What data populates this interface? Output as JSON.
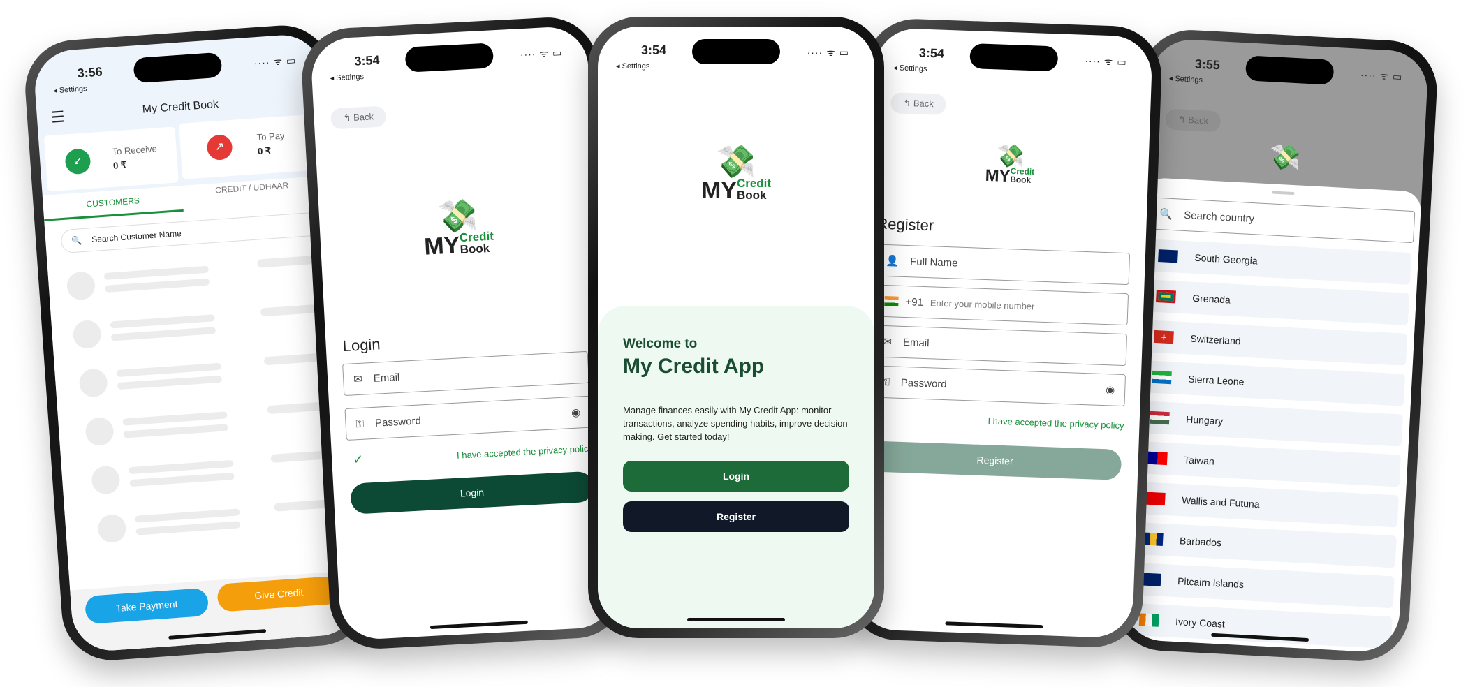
{
  "status": {
    "settings": "◂ Settings",
    "signal": "···· ᯤ ▭"
  },
  "logo": {
    "my": "MY",
    "credit": "Credit",
    "book": "Book"
  },
  "home": {
    "time": "3:56",
    "title": "My Credit Book",
    "receive_label": "To Receive",
    "receive_value": "0 ₹",
    "pay_label": "To Pay",
    "pay_value": "0 ₹",
    "tabs": [
      "CUSTOMERS",
      "CREDIT / UDHAAR"
    ],
    "search_placeholder": "Search Customer Name",
    "take_payment": "Take Payment",
    "give_credit": "Give Credit",
    "colors": {
      "receive": "#1e9e4f",
      "pay": "#e53935",
      "take": "#19a4e8",
      "give": "#f59e0b",
      "tab_active": "#1a8f3c"
    }
  },
  "login": {
    "time": "3:54",
    "back": "Back",
    "heading": "Login",
    "email": "Email",
    "password": "Password",
    "privacy": "I have accepted the privacy policy",
    "button": "Login",
    "button_color": "#0c4a35"
  },
  "welcome": {
    "time": "3:54",
    "welcome_to": "Welcome to",
    "app_name": "My Credit App",
    "description": "Manage finances easily with My Credit App: monitor transactions, analyze spending habits, improve decision making. Get started today!",
    "login": "Login",
    "register": "Register",
    "colors": {
      "panel": "#eefaf1",
      "login": "#1e6b3a",
      "register": "#111827"
    }
  },
  "register": {
    "time": "3:54",
    "back": "Back",
    "heading": "Register",
    "full_name": "Full Name",
    "code": "+91",
    "mobile_placeholder": "Enter your mobile number",
    "email": "Email",
    "password": "Password",
    "privacy": "I have accepted the privacy policy",
    "button": "Register",
    "button_color": "#86a89b"
  },
  "country": {
    "time": "3:55",
    "back": "Back",
    "search_placeholder": "Search country",
    "items": [
      "South Georgia",
      "Grenada",
      "Switzerland",
      "Sierra Leone",
      "Hungary",
      "Taiwan",
      "Wallis and Futuna",
      "Barbados",
      "Pitcairn Islands",
      "Ivory Coast"
    ]
  }
}
